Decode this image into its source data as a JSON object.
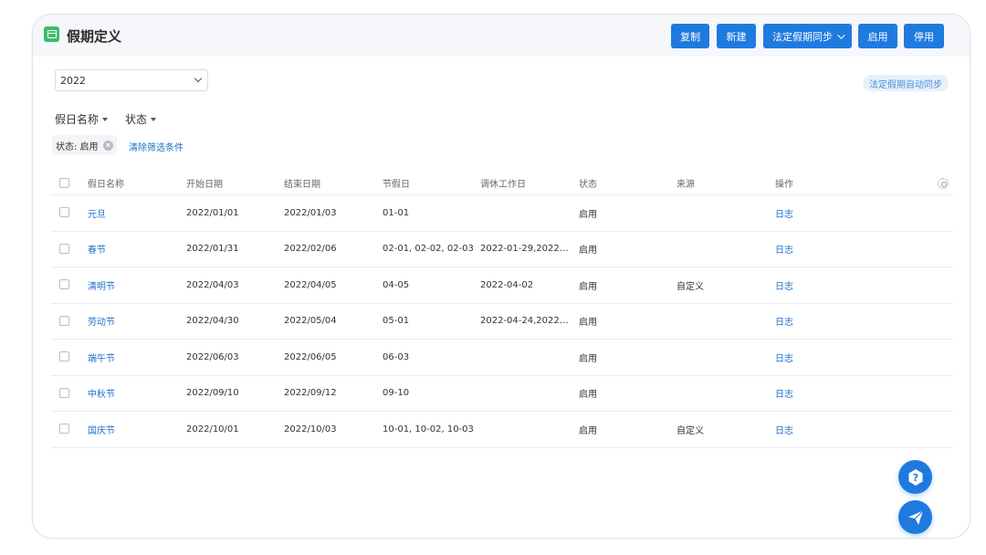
{
  "header": {
    "title": "假期定义",
    "buttons": {
      "copy": "复制",
      "new": "新建",
      "sync": "法定假期同步",
      "enable": "启用",
      "disable": "停用"
    }
  },
  "year_select": {
    "value": "2022"
  },
  "auto_sync_label": "法定假期自动同步",
  "filters": {
    "holiday_name": "假日名称",
    "status": "状态"
  },
  "active_filter": {
    "label": "状态: 启用"
  },
  "clear_filters": "清除筛选条件",
  "table": {
    "columns": [
      "假日名称",
      "开始日期",
      "结束日期",
      "节假日",
      "调休工作日",
      "状态",
      "来源",
      "操作"
    ],
    "rows": [
      {
        "name": "元旦",
        "start": "2022/01/01",
        "end": "2022/01/03",
        "holidays": "01-01",
        "workdays": "",
        "status": "启用",
        "source": "",
        "action": "日志"
      },
      {
        "name": "春节",
        "start": "2022/01/31",
        "end": "2022/02/06",
        "holidays": "02-01, 02-02, 02-03",
        "workdays": "2022-01-29,2022…",
        "status": "启用",
        "source": "",
        "action": "日志"
      },
      {
        "name": "清明节",
        "start": "2022/04/03",
        "end": "2022/04/05",
        "holidays": "04-05",
        "workdays": "2022-04-02",
        "status": "启用",
        "source": "自定义",
        "action": "日志"
      },
      {
        "name": "劳动节",
        "start": "2022/04/30",
        "end": "2022/05/04",
        "holidays": "05-01",
        "workdays": "2022-04-24,2022…",
        "status": "启用",
        "source": "",
        "action": "日志"
      },
      {
        "name": "端午节",
        "start": "2022/06/03",
        "end": "2022/06/05",
        "holidays": "06-03",
        "workdays": "",
        "status": "启用",
        "source": "",
        "action": "日志"
      },
      {
        "name": "中秋节",
        "start": "2022/09/10",
        "end": "2022/09/12",
        "holidays": "09-10",
        "workdays": "",
        "status": "启用",
        "source": "",
        "action": "日志"
      },
      {
        "name": "国庆节",
        "start": "2022/10/01",
        "end": "2022/10/03",
        "holidays": "10-01, 10-02, 10-03",
        "workdays": "",
        "status": "启用",
        "source": "自定义",
        "action": "日志"
      }
    ]
  },
  "colors": {
    "primary": "#1f7ae0",
    "link": "#1f6fc8",
    "app_icon": "#3dbb6c"
  },
  "icons": {
    "app": "calendar-icon",
    "settings": "gear-icon",
    "help": "help-icon",
    "send": "paper-plane-icon"
  }
}
